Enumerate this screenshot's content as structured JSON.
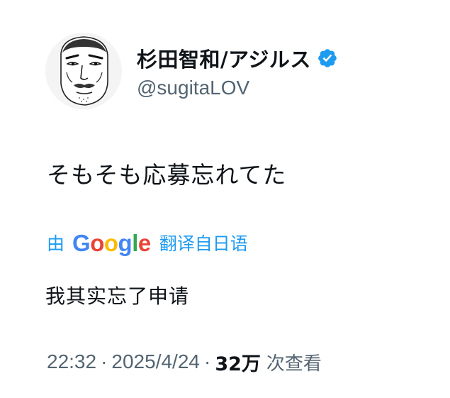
{
  "author": {
    "display_name": "杉田智和/アジルス",
    "handle": "@sugitaLOV",
    "verified": true,
    "verified_icon": "verified-badge-icon",
    "avatar": "avatar-sketch-face"
  },
  "tweet": {
    "text": "そもそも応募忘れてた"
  },
  "translation": {
    "prefix": "由",
    "provider_letters": [
      "G",
      "o",
      "o",
      "g",
      "l",
      "e"
    ],
    "suffix": "翻译自日语",
    "translated_text": "我其实忘了申请"
  },
  "meta": {
    "time": "22:32",
    "separator": "·",
    "date": "2025/4/24",
    "views_count": "32万",
    "views_label": "次查看"
  },
  "colors": {
    "link": "#1d9bf0",
    "secondary_text": "#536471",
    "primary_text": "#0f1419",
    "verified": "#1d9bf0",
    "google_blue": "#4285f4",
    "google_red": "#ea4335",
    "google_yellow": "#fbbc05",
    "google_green": "#34a853"
  }
}
